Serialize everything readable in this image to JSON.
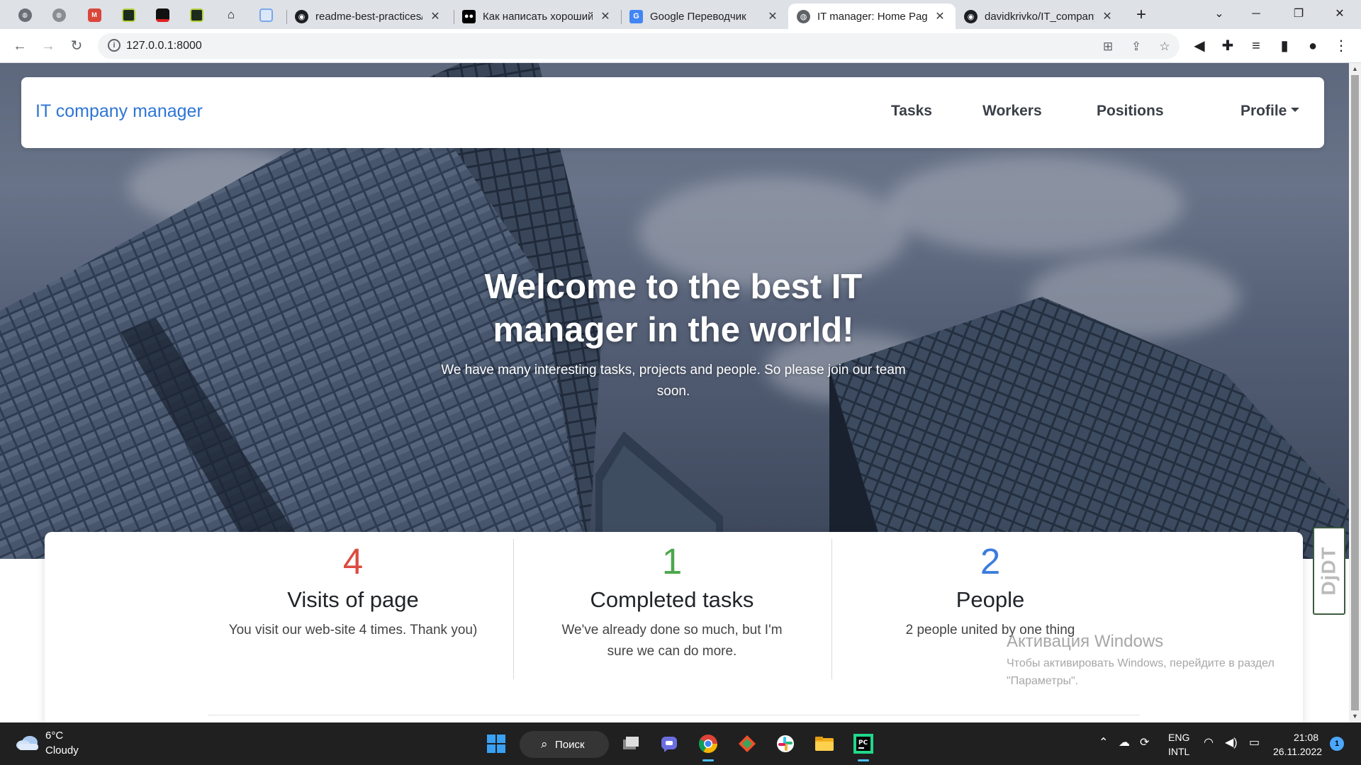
{
  "browser": {
    "tabs": [
      {
        "title": "readme-best-practices/",
        "close": "✕"
      },
      {
        "title": "Как написать хороший",
        "close": "✕"
      },
      {
        "title": "Google Переводчик",
        "close": "✕"
      },
      {
        "title": "IT manager: Home Page",
        "close": "✕",
        "active": true
      },
      {
        "title": "davidkrivko/IT_company",
        "close": "✕"
      }
    ],
    "new_tab": "+",
    "url": "127.0.0.1:8000"
  },
  "page": {
    "brand": "IT company manager",
    "nav": {
      "tasks": "Tasks",
      "workers": "Workers",
      "positions": "Positions",
      "profile": "Profile"
    },
    "hero": {
      "title": "Welcome to the best IT manager in the world!",
      "subtitle": "We have many interesting tasks, projects and people. So please join our team soon."
    },
    "stats": [
      {
        "number": "4",
        "label": "Visits of page",
        "description": "You visit our web-site 4 times. Thank you)",
        "color": "#dc4b3f"
      },
      {
        "number": "1",
        "label": "Completed tasks",
        "description": "We've already done so much, but I'm sure we can do more.",
        "color": "#4ca64c"
      },
      {
        "number": "2",
        "label": "People",
        "description": "2 people united by one thing",
        "color": "#3b7ddd"
      }
    ],
    "debug_toolbar": "DjDT"
  },
  "watermark": {
    "title": "Активация Windows",
    "line1": "Чтобы активировать Windows, перейдите в раздел",
    "line2": "\"Параметры\"."
  },
  "taskbar": {
    "weather_temp": "6°C",
    "weather_desc": "Cloudy",
    "search": "Поиск",
    "lang_1": "ENG",
    "lang_2": "INTL",
    "time": "21:08",
    "date": "26.11.2022",
    "notification_count": "1"
  }
}
